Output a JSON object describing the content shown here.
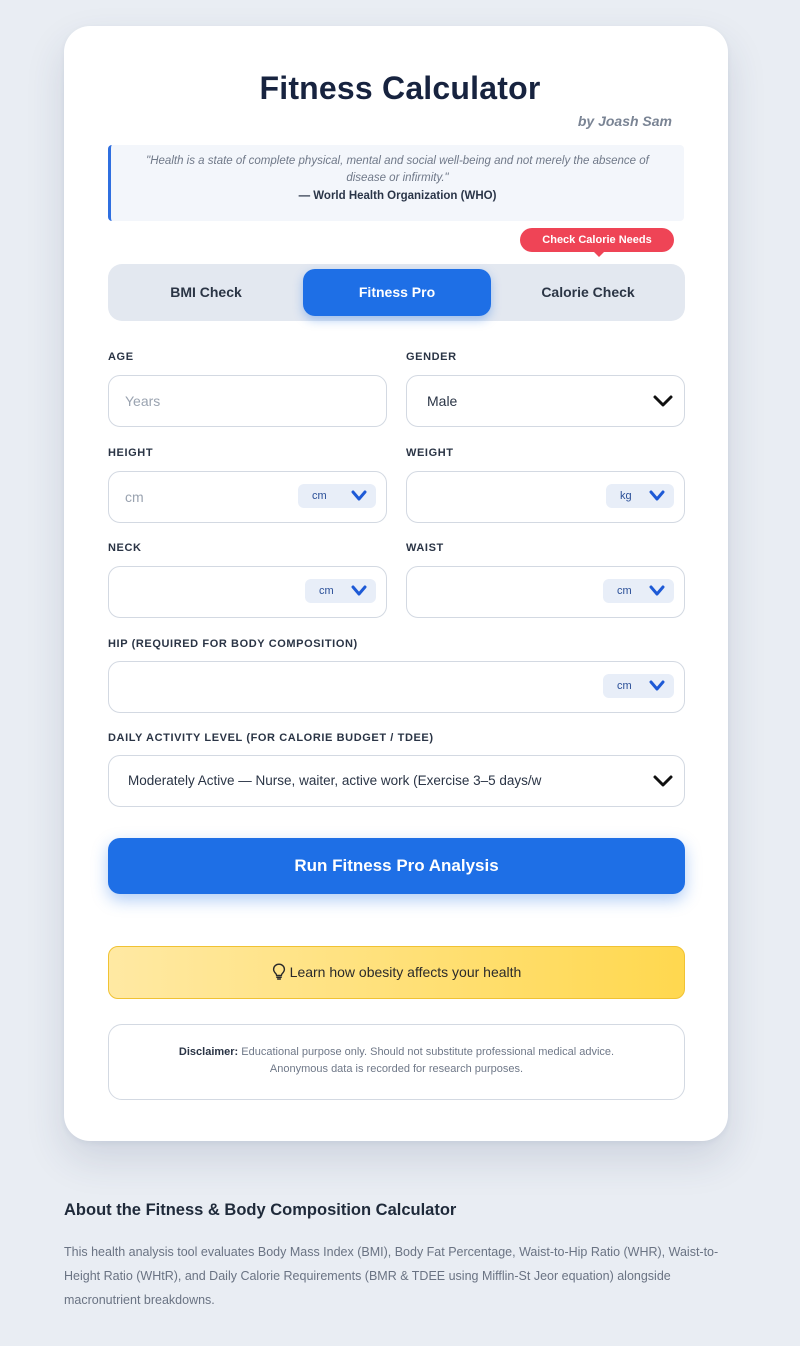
{
  "header": {
    "title": "Fitness Calculator",
    "author": "by Joash Sam"
  },
  "quote": {
    "text": "\"Health is a state of complete physical, mental and social well-being and not merely the absence of disease or infirmity.\"",
    "source": "— World Health Organization (WHO)"
  },
  "badge": "Check Calorie Needs",
  "tabs": [
    {
      "label": "BMI Check",
      "active": false
    },
    {
      "label": "Fitness Pro",
      "active": true
    },
    {
      "label": "Calorie Check",
      "active": false
    }
  ],
  "form": {
    "age": {
      "label": "AGE",
      "placeholder": "Years",
      "value": ""
    },
    "gender": {
      "label": "GENDER",
      "value": "Male"
    },
    "height": {
      "label": "HEIGHT",
      "placeholder": "cm",
      "value": "",
      "unit": "cm"
    },
    "weight": {
      "label": "WEIGHT",
      "placeholder": "",
      "value": "",
      "unit": "kg"
    },
    "neck": {
      "label": "NECK",
      "placeholder": "",
      "value": "",
      "unit": "cm"
    },
    "waist": {
      "label": "WAIST",
      "placeholder": "",
      "value": "",
      "unit": "cm"
    },
    "hip": {
      "label": "HIP (REQUIRED FOR BODY COMPOSITION)",
      "placeholder": "",
      "value": "",
      "unit": "cm"
    },
    "activity": {
      "label": "DAILY ACTIVITY LEVEL (FOR CALORIE BUDGET / TDEE)",
      "value": "Moderately Active — Nurse, waiter, active work (Exercise 3–5 days/w"
    }
  },
  "actions": {
    "run": "Run Fitness Pro Analysis",
    "learn": "Learn how obesity affects your health"
  },
  "disclaimer": {
    "label": "Disclaimer:",
    "line1": "Educational purpose only. Should not substitute professional medical advice.",
    "line2": "Anonymous data is recorded for research purposes."
  },
  "about": {
    "heading": "About the Fitness & Body Composition Calculator",
    "text": "This health analysis tool evaluates Body Mass Index (BMI), Body Fat Percentage, Waist-to-Hip Ratio (WHR), Waist-to-Height Ratio (WHtR), and Daily Calorie Requirements (BMR & TDEE using Mifflin-St Jeor equation) alongside macronutrient breakdowns."
  },
  "colors": {
    "primary": "#1e6fe6",
    "badge": "#ef4456",
    "highlight": "#ffd84f"
  }
}
